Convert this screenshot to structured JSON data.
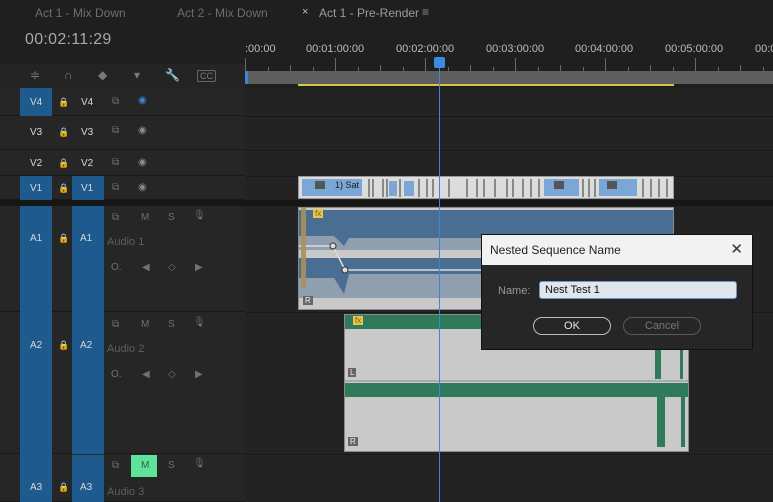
{
  "tabs": [
    {
      "label": "Act 1 - Mix Down"
    },
    {
      "label": "Act 2 - Mix Down"
    },
    {
      "label": "Act 1 - Pre-Render",
      "close": "×",
      "menu": "≡"
    }
  ],
  "timecode": "00:02:11:29",
  "ruler": {
    "labels": [
      ":00:00",
      "00:01:00:00",
      "00:02:00:00",
      "00:03:00:00",
      "00:04:00:00",
      "00:05:00:00",
      "00:0"
    ]
  },
  "toolbar": {
    "snap_icon": "≑",
    "link_icon": "∩",
    "marker_flag_icon": "◆",
    "marker_icon": "▾",
    "wrench_icon": "🔧",
    "cc_label": "CC"
  },
  "tracks": {
    "video": [
      {
        "source": "V4",
        "target": "V4"
      },
      {
        "source": "V3",
        "target": "V3"
      },
      {
        "source": "V2",
        "target": "V2"
      },
      {
        "source": "V1",
        "target": "V1"
      }
    ],
    "audio": [
      {
        "source": "A1",
        "target": "A1",
        "name": "Audio 1",
        "m": "M",
        "s": "S",
        "volume": "O."
      },
      {
        "source": "A2",
        "target": "A2",
        "name": "Audio 2",
        "m": "M",
        "s": "S",
        "volume": "O."
      },
      {
        "source": "A3",
        "target": "A3",
        "name": "Audio 3",
        "m": "M",
        "s": "S"
      }
    ]
  },
  "clips": {
    "v1_label": "1) Sat",
    "fx": "fx",
    "channel_r": "R",
    "channel_l": "L"
  },
  "dialog": {
    "title": "Nested Sequence Name",
    "close": "✕",
    "name_label": "Name:",
    "name_value": "Nest Test 1",
    "ok": "OK",
    "cancel": "Cancel"
  },
  "colors": {
    "accent": "#1e5a8e",
    "playhead": "#3c86d8",
    "audio_a1": "#4a6e92",
    "audio_a2": "#2f7a5a",
    "mute_active": "#5fe39a"
  }
}
